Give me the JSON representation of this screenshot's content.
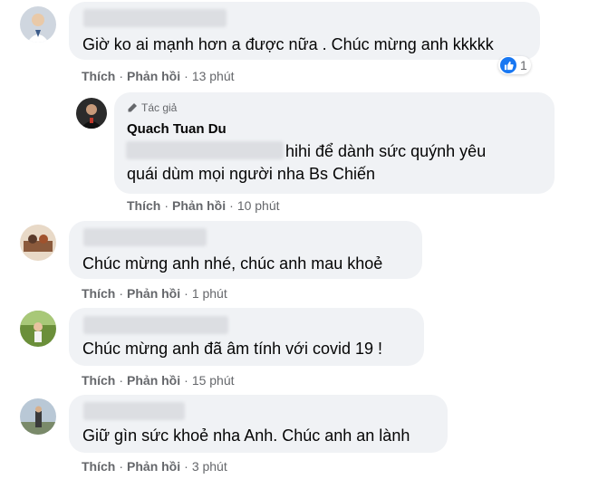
{
  "colors": {
    "bubble": "#f0f2f5",
    "like_blue": "#1877f2",
    "meta_text": "#65676b"
  },
  "actions": {
    "like": "Thích",
    "reply": "Phản hồi",
    "separator": "·"
  },
  "comments": [
    {
      "text": "Giờ ko ai mạnh hơn a được nữa . Chúc mừng anh kkkkk",
      "time": "13 phút",
      "reaction_count": "1",
      "reaction_icon": "like-icon"
    },
    {
      "author_badge": "Tác giả",
      "author": "Quach Tuan Du",
      "text_line1": "hihi để dành sức quýnh yêu",
      "text_line2": "quái dùm mọi người nha Bs Chiến",
      "time": "10 phút"
    },
    {
      "text": "Chúc mừng anh nhé, chúc anh mau khoẻ",
      "time": "1 phút"
    },
    {
      "text": "Chúc mừng anh đã âm tính với covid 19 !",
      "time": "15 phút"
    },
    {
      "text": "Giữ gìn sức khoẻ nha Anh. Chúc anh an lành",
      "time": "3 phút"
    }
  ]
}
